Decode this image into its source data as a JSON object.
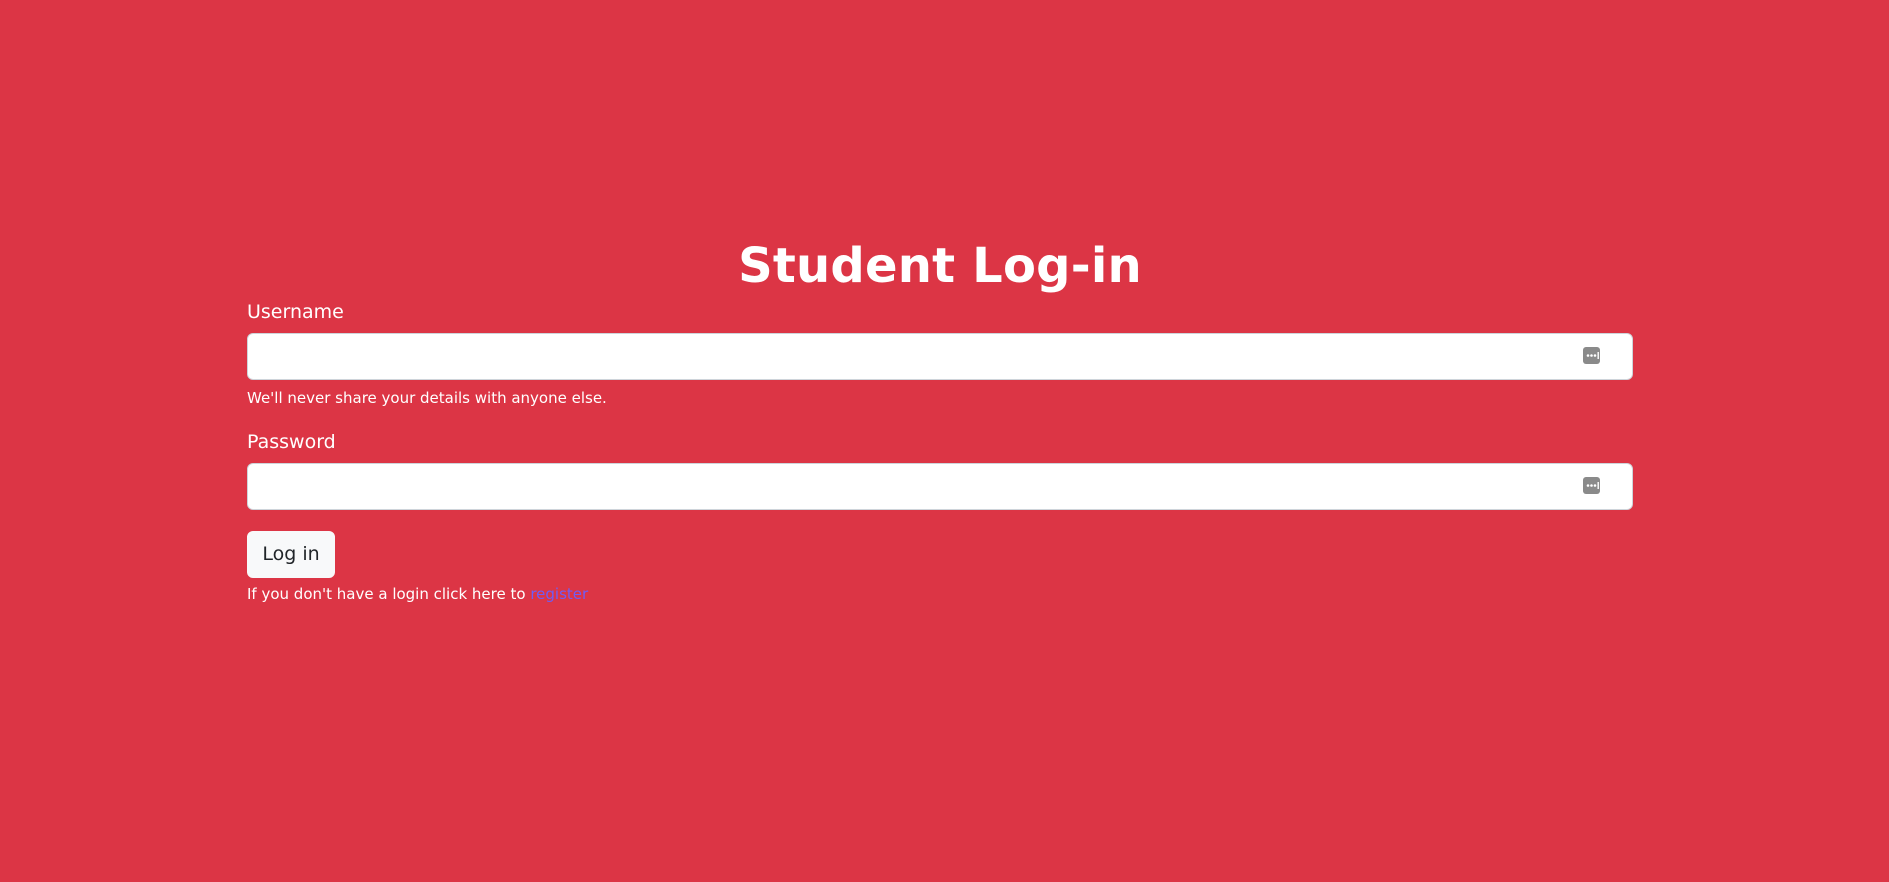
{
  "page": {
    "title": "Student Log-in",
    "background_color": "#dc3545"
  },
  "form": {
    "username": {
      "label": "Username",
      "value": "",
      "placeholder": "",
      "help_text": "We'll never share your details with anyone else.",
      "icon": "password-manager-key-icon"
    },
    "password": {
      "label": "Password",
      "value": "",
      "placeholder": "",
      "icon": "password-manager-key-icon"
    },
    "login_button_label": "Log in",
    "register_prompt": "If you don't have a login click here to ",
    "register_link_label": "register",
    "link_color": "#6f5cf5"
  }
}
